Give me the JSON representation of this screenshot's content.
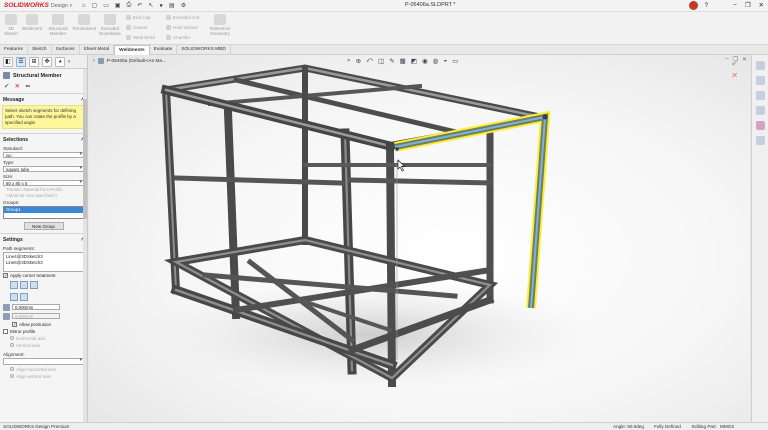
{
  "app": {
    "brand": "SOLIDWORKS",
    "product": "Design",
    "document_title": "P-05406a.SLDPRT *"
  },
  "ribbon": {
    "large_buttons": [
      "3D Sketch",
      "Weldment",
      "Structural Member",
      "Trim/Extend",
      "Extruded Boss/Base"
    ],
    "small_buttons": [
      "End Cap",
      "Gusset",
      "Weld Bead",
      "Extruded Cut",
      "Hole Wizard",
      "Chamfer"
    ],
    "reference_geometry": "Reference Geometry"
  },
  "tabs": [
    {
      "label": "Features",
      "active": false
    },
    {
      "label": "Sketch",
      "active": false
    },
    {
      "label": "Surfaces",
      "active": false
    },
    {
      "label": "Sheet Metal",
      "active": false
    },
    {
      "label": "Weldments",
      "active": true
    },
    {
      "label": "Evaluate",
      "active": false
    },
    {
      "label": "SOLIDWORKS MBD",
      "active": false
    }
  ],
  "panel": {
    "title": "Structural Member",
    "message_header": "Message",
    "message": "Select sketch segments for defining path. You can rotate the profile by a specified angle.",
    "selections_header": "Selections",
    "standard_label": "Standard:",
    "standard_value": "iso",
    "type_label": "Type:",
    "type_value": "square tube",
    "size_label": "Size:",
    "size_value": "80 x 80 x 5",
    "transfer_material": "Transfer Material from Profile",
    "material_not_specified": "<Material <not specified>>",
    "groups_label": "Groups:",
    "group_item": "Group1",
    "new_group_button": "New Group",
    "settings_header": "Settings",
    "path_segments_label": "Path segments:",
    "path_segments": [
      "Line4@3DSketch3",
      "Line6@3DSketch3"
    ],
    "apply_corner_treatment": "Apply corner treatment",
    "gap1": "0.000mm",
    "gap2": "0.000mm",
    "allow_protrusion": "Allow protrusion",
    "mirror_profile": "Mirror profile",
    "horizontal_axis": "Horizontal axis",
    "vertical_axis": "Vertical axis",
    "alignment_label": "Alignment:",
    "align_horizontal": "Align horizontal axis",
    "align_vertical": "Align vertical axis"
  },
  "viewport": {
    "tree_label": "P-05406a (Default<As Ma..."
  },
  "status": {
    "left": "SOLIDWORKS Design Premium",
    "angle": "Angle: 90.0deg",
    "defined": "Fully Defined",
    "editing": "Editing Part",
    "units": "MMGS"
  },
  "colors": {
    "brand_red": "#d71f26",
    "selection_yellow": "#f7ef3a",
    "selection_blue": "#6fb7e4",
    "steel": "#5a5a5a",
    "message_yellow": "#fdf79a"
  }
}
